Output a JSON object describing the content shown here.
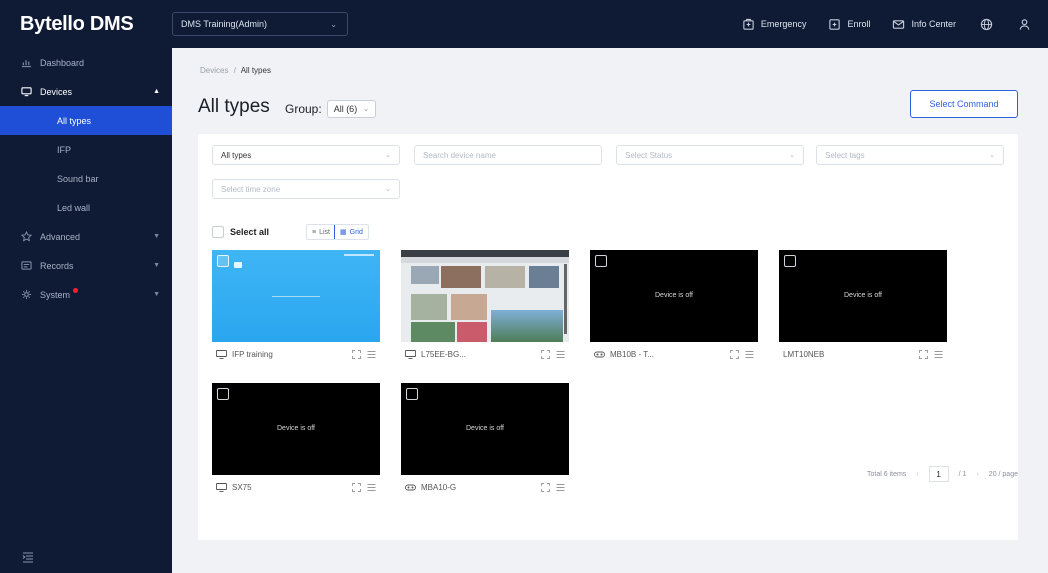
{
  "app": {
    "brand": "Bytello DMS"
  },
  "header": {
    "org_select": "DMS Training(Admin)",
    "actions": [
      {
        "label": "Emergency",
        "icon": "emergency-icon"
      },
      {
        "label": "Enroll",
        "icon": "enroll-icon"
      },
      {
        "label": "Info Center",
        "icon": "mail-icon"
      }
    ],
    "icons": [
      "globe-icon",
      "user-icon"
    ]
  },
  "sidebar": {
    "items": [
      {
        "label": "Dashboard",
        "icon": "dashboard-icon"
      },
      {
        "label": "Devices",
        "icon": "monitor-icon"
      },
      {
        "label": "Advanced",
        "icon": "star-icon"
      },
      {
        "label": "Records",
        "icon": "records-icon"
      },
      {
        "label": "System",
        "icon": "gear-icon"
      }
    ],
    "devices_sub": [
      "All types",
      "IFP",
      "Sound bar",
      "Led wall"
    ],
    "active_sub": "All types"
  },
  "breadcrumb": {
    "parent": "Devices",
    "separator": "/",
    "current": "All types"
  },
  "page": {
    "title": "All types",
    "group_label": "Group:",
    "group_value": "All (6)",
    "select_command": "Select Command"
  },
  "filters": {
    "type_value": "All types",
    "search_placeholder": "Search device name",
    "status_placeholder": "Select Status",
    "tags_placeholder": "Select tags",
    "timezone_placeholder": "Select time zone"
  },
  "list_controls": {
    "select_all": "Select all",
    "list_label": "List",
    "grid_label": "Grid"
  },
  "devices": [
    {
      "name": "IFP training",
      "status_text": "",
      "device_icon": "monitor-icon",
      "screen": "blue"
    },
    {
      "name": "L75EE-BG...",
      "status_text": "",
      "device_icon": "monitor-icon",
      "screen": "screenshot"
    },
    {
      "name": "MB10B - T...",
      "status_text": "Device is off",
      "device_icon": "soundbar-icon",
      "screen": "off"
    },
    {
      "name": "LMT10NEB",
      "status_text": "Device is off",
      "device_icon": "",
      "screen": "off"
    },
    {
      "name": "SX75",
      "status_text": "Device is off",
      "device_icon": "monitor-icon",
      "screen": "off"
    },
    {
      "name": "MBA10-G",
      "status_text": "Device is off",
      "device_icon": "soundbar-icon",
      "screen": "off"
    }
  ],
  "pagination": {
    "total": "Total 6 items",
    "page": "1",
    "of": "/ 1",
    "per_page": "20 / page"
  }
}
